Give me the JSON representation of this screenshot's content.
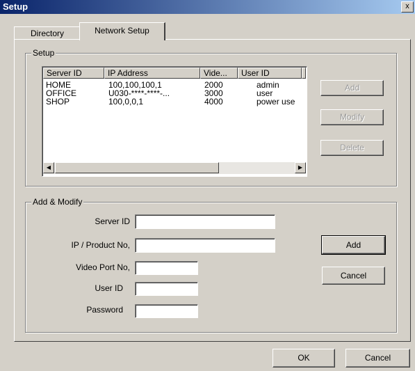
{
  "window": {
    "title": "Setup",
    "close_glyph": "x"
  },
  "tabs": [
    "Directory",
    "Network Setup"
  ],
  "setup": {
    "legend": "Setup",
    "columns": [
      "Server ID",
      "IP Address",
      "Vide...",
      "User ID"
    ],
    "rows": [
      [
        "HOME",
        "100,100,100,1",
        "2000",
        "admin"
      ],
      [
        "OFFICE",
        "U030-****-****-...",
        "3000",
        "user"
      ],
      [
        "SHOP",
        "100,0,0,1",
        "4000",
        "power use"
      ]
    ],
    "buttons": {
      "add": "Add",
      "modify": "Modify",
      "delete": "Delete"
    }
  },
  "add_modify": {
    "legend": "Add & Modify",
    "labels": {
      "server_id": "Server ID",
      "ip": "IP / Product No,",
      "video_port": "Video Port No,",
      "user_id": "User ID",
      "password": "Password"
    },
    "values": {
      "server_id": "",
      "ip": "",
      "video_port": "",
      "user_id": "",
      "password": ""
    },
    "buttons": {
      "add": "Add",
      "cancel": "Cancel"
    }
  },
  "footer": {
    "ok": "OK",
    "cancel": "Cancel"
  }
}
